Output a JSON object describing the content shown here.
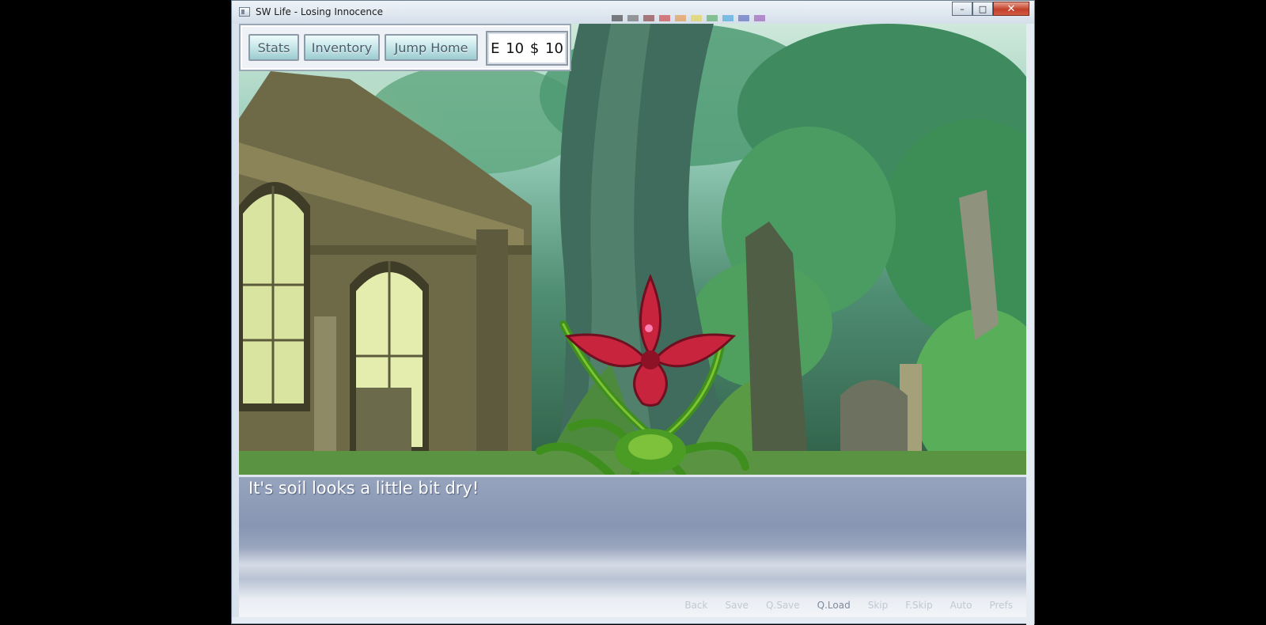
{
  "window": {
    "title": "SW Life - Losing Innocence",
    "controls": {
      "minimize": "–",
      "maximize": "□",
      "close": "✕"
    }
  },
  "hud": {
    "buttons": [
      "Stats",
      "Inventory",
      "Jump Home"
    ],
    "stat_display": "E 10  $ 10"
  },
  "dialogue": {
    "text": "It's soil looks a little bit dry!"
  },
  "quick_menu": [
    "Back",
    "Save",
    "Q.Save",
    "Q.Load",
    "Skip",
    "F.Skip",
    "Auto",
    "Prefs"
  ],
  "colors": {
    "flower_petal": "#c8243e",
    "vine": "#3f8f1f",
    "dialogue_text": "#ffffff"
  }
}
